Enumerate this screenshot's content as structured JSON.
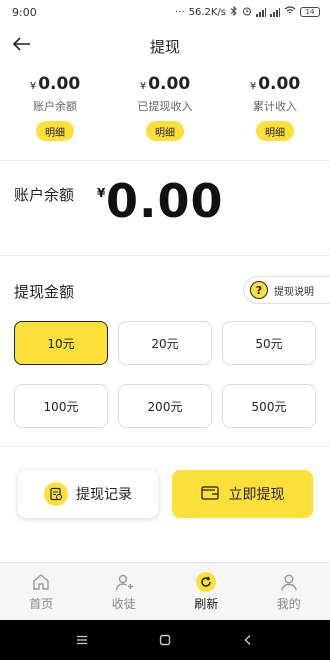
{
  "status_bar": {
    "time": "9:00",
    "network_speed": "56.2K/s",
    "battery": "14"
  },
  "nav": {
    "title": "提现"
  },
  "stats": [
    {
      "currency": "¥",
      "amount": "0.00",
      "label": "账户余额",
      "button": "明细"
    },
    {
      "currency": "¥",
      "amount": "0.00",
      "label": "已提现收入",
      "button": "明细"
    },
    {
      "currency": "¥",
      "amount": "0.00",
      "label": "累计收入",
      "button": "明细"
    }
  ],
  "balance": {
    "label": "账户余额",
    "currency": "¥",
    "value": "0.00"
  },
  "amount_section": {
    "title": "提现金额",
    "explain_label": "提现说明",
    "options": [
      "10元",
      "20元",
      "50元",
      "100元",
      "200元",
      "500元"
    ],
    "selected": "10元"
  },
  "actions": {
    "record_label": "提现记录",
    "withdraw_label": "立即提现"
  },
  "bottom_nav": [
    {
      "label": "首页",
      "icon": "home-icon"
    },
    {
      "label": "收徒",
      "icon": "add-user-icon"
    },
    {
      "label": "刷新",
      "icon": "refresh-icon",
      "active": true
    },
    {
      "label": "我的",
      "icon": "person-icon"
    }
  ],
  "colors": {
    "accent": "#fde13a",
    "text": "#222222",
    "muted": "#888888"
  }
}
